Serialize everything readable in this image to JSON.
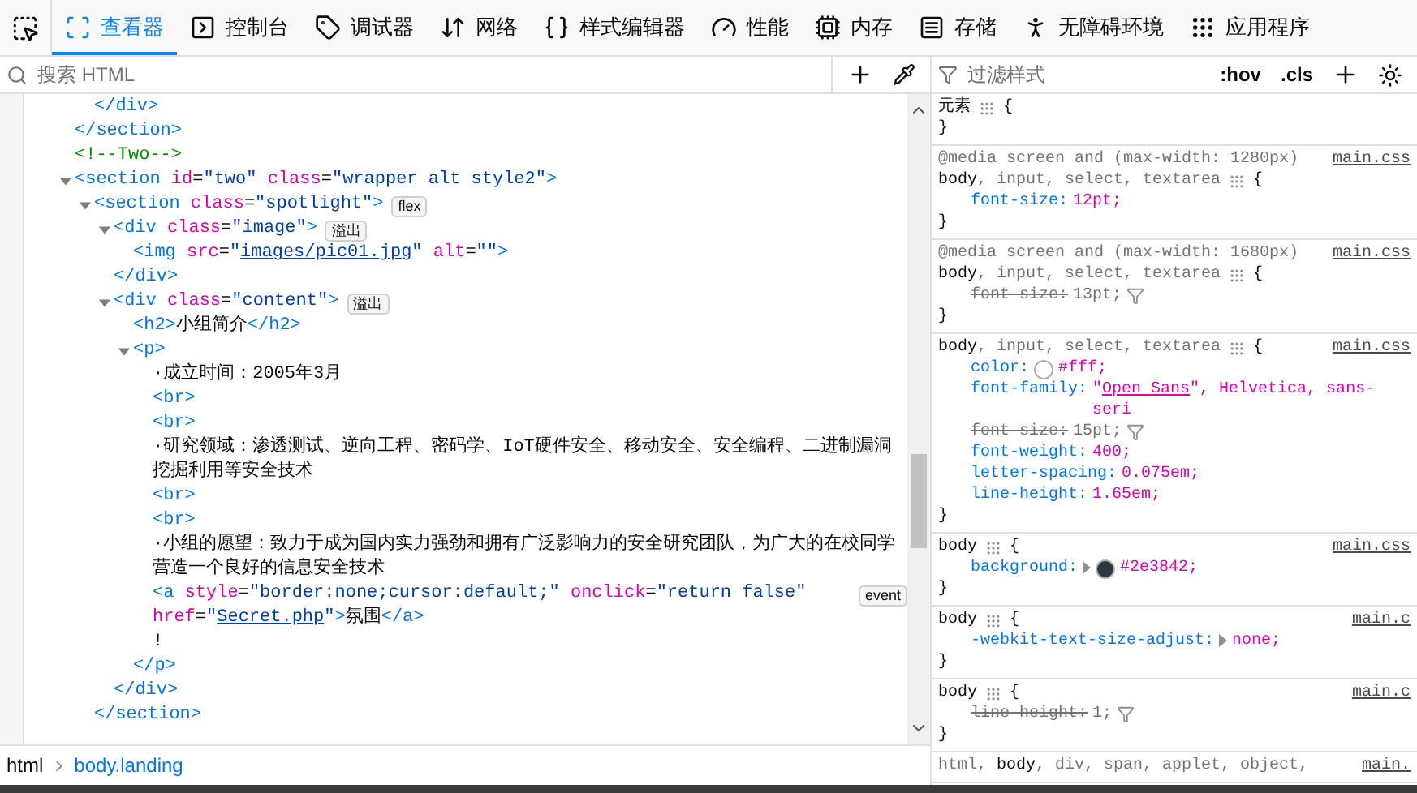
{
  "toolbar": {
    "tabs": [
      {
        "kind": "inspector",
        "label": "查看器",
        "selected": true
      },
      {
        "kind": "console",
        "label": "控制台",
        "selected": false
      },
      {
        "kind": "debugger",
        "label": "调试器",
        "selected": false
      },
      {
        "kind": "network",
        "label": "网络",
        "selected": false
      },
      {
        "kind": "style",
        "label": "样式编辑器",
        "selected": false
      },
      {
        "kind": "performance",
        "label": "性能",
        "selected": false
      },
      {
        "kind": "memory",
        "label": "内存",
        "selected": false
      },
      {
        "kind": "storage",
        "label": "存储",
        "selected": false
      },
      {
        "kind": "accessibility",
        "label": "无障碍环境",
        "selected": false
      },
      {
        "kind": "application",
        "label": "应用程序",
        "selected": false
      }
    ]
  },
  "markup": {
    "search": {
      "placeholder": "搜索 HTML"
    },
    "nodes": [
      {
        "children": [
          {
            "line": [
              {
                "kind": "tag",
                "text": "</div>"
              }
            ]
          }
        ],
        "close": [
          {
            "kind": "tag",
            "text": "</section>"
          }
        ]
      },
      {
        "line": [
          {
            "kind": "comment",
            "text": "<!--Two-->"
          }
        ]
      },
      {
        "expanded": true,
        "line": [
          {
            "kind": "tag",
            "text": "<section "
          },
          {
            "kind": "attr",
            "text": "id"
          },
          {
            "kind": "punct",
            "text": "="
          },
          {
            "kind": "value",
            "text": "\"two\" "
          },
          {
            "kind": "attr",
            "text": "class"
          },
          {
            "kind": "punct",
            "text": "="
          },
          {
            "kind": "value",
            "text": "\"wrapper alt style2\""
          },
          {
            "kind": "tag",
            "text": ">"
          }
        ],
        "children": [
          {
            "expanded": true,
            "line": [
              {
                "kind": "tag",
                "text": "<section "
              },
              {
                "kind": "attr",
                "text": "class"
              },
              {
                "kind": "punct",
                "text": "="
              },
              {
                "kind": "value",
                "text": "\"spotlight\""
              },
              {
                "kind": "tag",
                "text": ">"
              }
            ],
            "badge": "flex",
            "children": [
              {
                "expanded": true,
                "line": [
                  {
                    "kind": "tag",
                    "text": "<div "
                  },
                  {
                    "kind": "attr",
                    "text": "class"
                  },
                  {
                    "kind": "punct",
                    "text": "="
                  },
                  {
                    "kind": "value",
                    "text": "\"image\""
                  },
                  {
                    "kind": "tag",
                    "text": ">"
                  }
                ],
                "badge": "溢出",
                "children": [
                  {
                    "line": [
                      {
                        "kind": "tag",
                        "text": "<img "
                      },
                      {
                        "kind": "attr",
                        "text": "src"
                      },
                      {
                        "kind": "punct",
                        "text": "="
                      },
                      {
                        "kind": "value",
                        "text": "\""
                      },
                      {
                        "kind": "link",
                        "text": "images/pic01.jpg"
                      },
                      {
                        "kind": "value",
                        "text": "\" "
                      },
                      {
                        "kind": "attr",
                        "text": "alt"
                      },
                      {
                        "kind": "punct",
                        "text": "="
                      },
                      {
                        "kind": "value",
                        "text": "\"\""
                      },
                      {
                        "kind": "tag",
                        "text": ">"
                      }
                    ]
                  }
                ],
                "close": [
                  {
                    "kind": "tag",
                    "text": "</div>"
                  }
                ]
              },
              {
                "expanded": true,
                "line": [
                  {
                    "kind": "tag",
                    "text": "<div "
                  },
                  {
                    "kind": "attr",
                    "text": "class"
                  },
                  {
                    "kind": "punct",
                    "text": "="
                  },
                  {
                    "kind": "value",
                    "text": "\"content\""
                  },
                  {
                    "kind": "tag",
                    "text": ">"
                  }
                ],
                "badge": "溢出",
                "children": [
                  {
                    "line": [
                      {
                        "kind": "tag",
                        "text": "<h2>"
                      },
                      {
                        "kind": "text",
                        "text": "小组简介"
                      },
                      {
                        "kind": "tag",
                        "text": "</h2>"
                      }
                    ]
                  },
                  {
                    "expanded": true,
                    "line": [
                      {
                        "kind": "tag",
                        "text": "<p>"
                      }
                    ],
                    "children": [
                      {
                        "line": [
                          {
                            "kind": "text",
                            "text": "·成立时间：2005年3月"
                          }
                        ]
                      },
                      {
                        "line": [
                          {
                            "kind": "tag",
                            "text": "<br>"
                          }
                        ]
                      },
                      {
                        "line": [
                          {
                            "kind": "tag",
                            "text": "<br>"
                          }
                        ]
                      },
                      {
                        "line": [
                          {
                            "kind": "text",
                            "text": "·研究领域：渗透测试、逆向工程、密码学、IoT硬件安全、移动安全、安全编程、二进制漏洞挖掘利用等安全技术"
                          }
                        ]
                      },
                      {
                        "line": [
                          {
                            "kind": "tag",
                            "text": "<br>"
                          }
                        ]
                      },
                      {
                        "line": [
                          {
                            "kind": "tag",
                            "text": "<br>"
                          }
                        ]
                      },
                      {
                        "line": [
                          {
                            "kind": "text",
                            "text": "·小组的愿望：致力于成为国内实力强劲和拥有广泛影响力的安全研究团队，为广大的在校同学营造一个良好的信息安全技术"
                          }
                        ]
                      },
                      {
                        "line": [
                          {
                            "kind": "tag",
                            "text": "<a "
                          },
                          {
                            "kind": "attr",
                            "text": "style"
                          },
                          {
                            "kind": "punct",
                            "text": "="
                          },
                          {
                            "kind": "value",
                            "text": "\"border:none;cursor:default;\" "
                          },
                          {
                            "kind": "attr",
                            "text": "onclick"
                          },
                          {
                            "kind": "punct",
                            "text": "="
                          },
                          {
                            "kind": "value",
                            "text": "\"return false\" "
                          },
                          {
                            "kind": "attr",
                            "text": "href"
                          },
                          {
                            "kind": "punct",
                            "text": "="
                          },
                          {
                            "kind": "value",
                            "text": "\""
                          },
                          {
                            "kind": "link",
                            "text": "Secret.php"
                          },
                          {
                            "kind": "value",
                            "text": "\""
                          },
                          {
                            "kind": "tag",
                            "text": ">"
                          },
                          {
                            "kind": "text",
                            "text": "氛围"
                          },
                          {
                            "kind": "tag",
                            "text": "</a>"
                          }
                        ],
                        "badge": "event"
                      },
                      {
                        "line": [
                          {
                            "kind": "text",
                            "text": "!"
                          }
                        ]
                      }
                    ],
                    "close": [
                      {
                        "kind": "tag",
                        "text": "</p>"
                      }
                    ]
                  }
                ],
                "close": [
                  {
                    "kind": "tag",
                    "text": "</div>"
                  }
                ]
              }
            ],
            "close": [
              {
                "kind": "tag",
                "text": "</section>"
              }
            ]
          }
        ]
      }
    ],
    "breadcrumbs": [
      {
        "label": "html",
        "selected": false
      },
      {
        "label": "body.landing",
        "selected": true
      }
    ]
  },
  "rules_panel": {
    "filter": {
      "placeholder": "过滤样式"
    },
    "buttons": [
      ":hov",
      ".cls"
    ],
    "rules": [
      {
        "selector": [
          {
            "text": "元素",
            "matched": true
          }
        ],
        "open": "{",
        "close": "}"
      },
      {
        "media": "@media screen and (max-width: 1280px)",
        "source": "main.css",
        "selector": [
          {
            "text": "body",
            "matched": true
          },
          {
            "text": ", input, select, textarea",
            "matched": false
          }
        ],
        "open": "{",
        "close": "}",
        "declarations": [
          {
            "property": "font-size:",
            "value": [
              {
                "text": "12pt;"
              }
            ],
            "overridden": false
          }
        ]
      },
      {
        "media": "@media screen and (max-width: 1680px)",
        "source": "main.css",
        "selector": [
          {
            "text": "body",
            "matched": true
          },
          {
            "text": ", input, select, textarea",
            "matched": false
          }
        ],
        "open": "{",
        "close": "}",
        "declarations": [
          {
            "property": "font-size:",
            "value": [
              {
                "text": "13pt;"
              }
            ],
            "overridden": true
          }
        ]
      },
      {
        "source": "main.css",
        "selector": [
          {
            "text": "body",
            "matched": true
          },
          {
            "text": ", input, select, textarea",
            "matched": false
          }
        ],
        "open": "{",
        "close": "}",
        "declarations": [
          {
            "property": "color:",
            "color": "#ffffff",
            "value": [
              {
                "text": "#fff;"
              }
            ],
            "overridden": false
          },
          {
            "property": "font-family:",
            "value": [
              {
                "text": "\""
              },
              {
                "text": "Open Sans",
                "link": true
              },
              {
                "text": "\", Helvetica, sans-seri"
              }
            ],
            "overridden": false
          },
          {
            "property": "font-size:",
            "value": [
              {
                "text": "15pt;"
              }
            ],
            "overridden": true
          },
          {
            "property": "font-weight:",
            "value": [
              {
                "text": "400;"
              }
            ],
            "overridden": false
          },
          {
            "property": "letter-spacing:",
            "value": [
              {
                "text": "0.075em;"
              }
            ],
            "overridden": false
          },
          {
            "property": "line-height:",
            "value": [
              {
                "text": "1.65em;"
              }
            ],
            "overridden": false
          }
        ]
      },
      {
        "source": "main.css",
        "selector": [
          {
            "text": "body",
            "matched": true
          }
        ],
        "open": "{",
        "close": "}",
        "declarations": [
          {
            "property": "background:",
            "expander": true,
            "color": "#2e3842",
            "value": [
              {
                "text": "#2e3842;"
              }
            ],
            "overridden": false
          }
        ]
      },
      {
        "source": "main.c",
        "selector": [
          {
            "text": "body",
            "matched": true
          }
        ],
        "open": "{",
        "close": "}",
        "declarations": [
          {
            "property": "-webkit-text-size-adjust:",
            "expander": true,
            "value": [
              {
                "text": "none;"
              }
            ],
            "overridden": false
          }
        ]
      },
      {
        "source": "main.c",
        "selector": [
          {
            "text": "body",
            "matched": true
          }
        ],
        "open": "{",
        "close": "}",
        "declarations": [
          {
            "property": "line-height:",
            "value": [
              {
                "text": "1;"
              }
            ],
            "overridden": true
          }
        ]
      },
      {
        "source": "main.",
        "selector": [
          {
            "text": "html, ",
            "matched": false
          },
          {
            "text": "body",
            "matched": true
          },
          {
            "text": ", div, span, applet, object,",
            "matched": false
          }
        ]
      }
    ]
  }
}
